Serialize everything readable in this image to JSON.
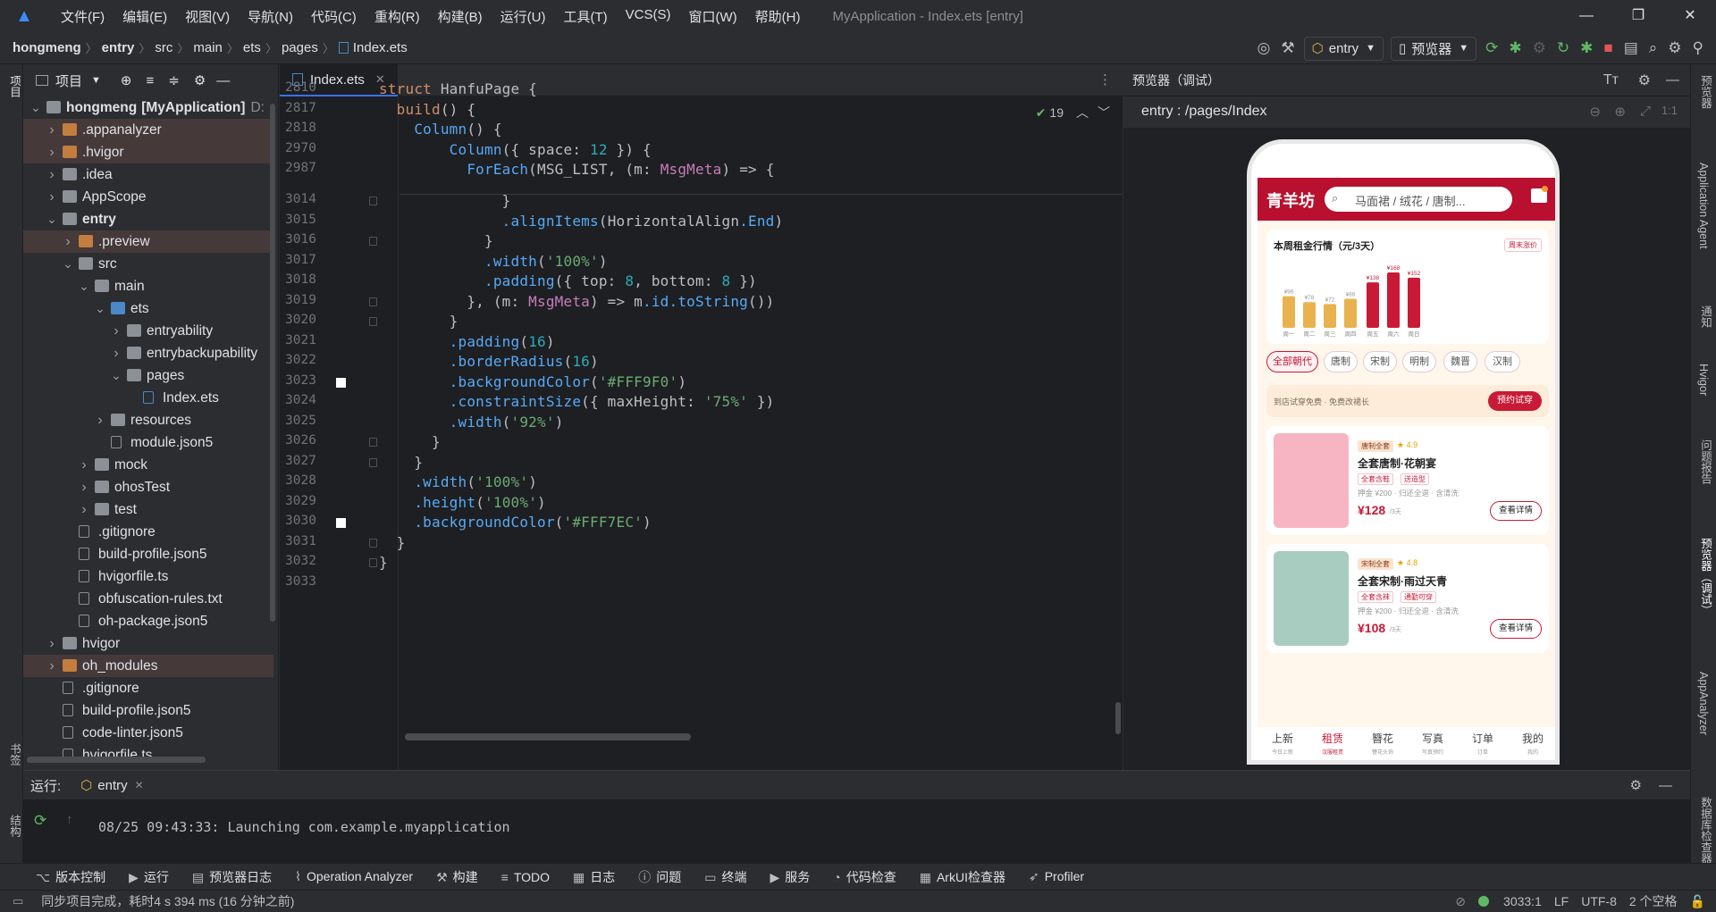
{
  "menubar": {
    "items": [
      "文件(F)",
      "编辑(E)",
      "视图(V)",
      "导航(N)",
      "代码(C)",
      "重构(R)",
      "构建(B)",
      "运行(U)",
      "工具(T)",
      "VCS(S)",
      "窗口(W)",
      "帮助(H)"
    ],
    "title": "MyApplication - Index.ets [entry]"
  },
  "breadcrumb": [
    "hongmeng",
    "entry",
    "src",
    "main",
    "ets",
    "pages",
    "Index.ets"
  ],
  "toolbar": {
    "config": "entry",
    "device": "预览器"
  },
  "project": {
    "header": "项目",
    "tree": [
      {
        "label": "hongmeng",
        "suffix": "[MyApplication]",
        "extra": "D:",
        "depth": 0,
        "open": true,
        "kind": "folder"
      },
      {
        "label": ".appanalyzer",
        "depth": 1,
        "kind": "folder-orange",
        "hl": true
      },
      {
        "label": ".hvigor",
        "depth": 1,
        "kind": "folder-orange",
        "hl": true
      },
      {
        "label": ".idea",
        "depth": 1,
        "kind": "folder"
      },
      {
        "label": "AppScope",
        "depth": 1,
        "kind": "folder"
      },
      {
        "label": "entry",
        "depth": 1,
        "open": true,
        "kind": "folder",
        "bold": true
      },
      {
        "label": ".preview",
        "depth": 2,
        "kind": "folder-orange",
        "hl": true
      },
      {
        "label": "src",
        "depth": 2,
        "open": true,
        "kind": "folder"
      },
      {
        "label": "main",
        "depth": 3,
        "open": true,
        "kind": "folder"
      },
      {
        "label": "ets",
        "depth": 4,
        "open": true,
        "kind": "folder-blue"
      },
      {
        "label": "entryability",
        "depth": 5,
        "kind": "folder"
      },
      {
        "label": "entrybackupability",
        "depth": 5,
        "kind": "folder"
      },
      {
        "label": "pages",
        "depth": 5,
        "open": true,
        "kind": "folder"
      },
      {
        "label": "Index.ets",
        "depth": 6,
        "kind": "ets",
        "noarrow": true
      },
      {
        "label": "resources",
        "depth": 4,
        "kind": "folder"
      },
      {
        "label": "module.json5",
        "depth": 4,
        "kind": "file",
        "noarrow": true
      },
      {
        "label": "mock",
        "depth": 3,
        "kind": "folder"
      },
      {
        "label": "ohosTest",
        "depth": 3,
        "kind": "folder"
      },
      {
        "label": "test",
        "depth": 3,
        "kind": "folder"
      },
      {
        "label": ".gitignore",
        "depth": 2,
        "kind": "file",
        "noarrow": true
      },
      {
        "label": "build-profile.json5",
        "depth": 2,
        "kind": "file",
        "noarrow": true
      },
      {
        "label": "hvigorfile.ts",
        "depth": 2,
        "kind": "file",
        "noarrow": true
      },
      {
        "label": "obfuscation-rules.txt",
        "depth": 2,
        "kind": "file",
        "noarrow": true
      },
      {
        "label": "oh-package.json5",
        "depth": 2,
        "kind": "file",
        "noarrow": true
      },
      {
        "label": "hvigor",
        "depth": 1,
        "kind": "folder"
      },
      {
        "label": "oh_modules",
        "depth": 1,
        "kind": "folder-orange",
        "hl": true
      },
      {
        "label": ".gitignore",
        "depth": 1,
        "kind": "file",
        "noarrow": true
      },
      {
        "label": "build-profile.json5",
        "depth": 1,
        "kind": "file",
        "noarrow": true
      },
      {
        "label": "code-linter.json5",
        "depth": 1,
        "kind": "file",
        "noarrow": true
      },
      {
        "label": "hvigorfile.ts",
        "depth": 1,
        "kind": "file",
        "noarrow": true
      }
    ]
  },
  "editor": {
    "tab": "Index.ets",
    "warnings": "19",
    "sticky": [
      {
        "ln": "2810",
        "code": "struct HanfuPage {"
      },
      {
        "ln": "2817",
        "code": "  build() {"
      },
      {
        "ln": "2818",
        "code": "    Column() {"
      },
      {
        "ln": "2970",
        "code": "        Column({ space: 12 }) {"
      },
      {
        "ln": "2987",
        "code": "          ForEach(MSG_LIST, (m: MsgMeta) => {"
      }
    ],
    "lines": [
      {
        "ln": "3014",
        "code": "              }"
      },
      {
        "ln": "3015",
        "code": "              .alignItems(HorizontalAlign.End)"
      },
      {
        "ln": "3016",
        "code": "            }"
      },
      {
        "ln": "3017",
        "code": "            .width('100%')"
      },
      {
        "ln": "3018",
        "code": "            .padding({ top: 8, bottom: 8 })"
      },
      {
        "ln": "3019",
        "code": "          }, (m: MsgMeta) => m.id.toString())"
      },
      {
        "ln": "3020",
        "code": "        }"
      },
      {
        "ln": "3021",
        "code": "        .padding(16)"
      },
      {
        "ln": "3022",
        "code": "        .borderRadius(16)"
      },
      {
        "ln": "3023",
        "code": "        .backgroundColor('#FFF9F0')"
      },
      {
        "ln": "3024",
        "code": "        .constraintSize({ maxHeight: '75%' })"
      },
      {
        "ln": "3025",
        "code": "        .width('92%')"
      },
      {
        "ln": "3026",
        "code": "      }"
      },
      {
        "ln": "3027",
        "code": "    }"
      },
      {
        "ln": "3028",
        "code": "    .width('100%')"
      },
      {
        "ln": "3029",
        "code": "    .height('100%')"
      },
      {
        "ln": "3030",
        "code": "    .backgroundColor('#FFF7EC')"
      },
      {
        "ln": "3031",
        "code": "  }"
      },
      {
        "ln": "3032",
        "code": "}"
      },
      {
        "ln": "3033",
        "code": ""
      }
    ]
  },
  "preview": {
    "header": "预览器（调试）",
    "route": "entry : /pages/Index",
    "app": {
      "brand": "青羊坊",
      "search_placeholder": "马面裙 / 绒花 / 唐制...",
      "chart_title": "本周租金行情（元/3天）",
      "chart_badge": "周末涨价",
      "chart_data": {
        "type": "bar",
        "categories": [
          "周一",
          "周二",
          "周三",
          "周四",
          "周五",
          "周六",
          "周日"
        ],
        "values": [
          96,
          78,
          72,
          88,
          138,
          168,
          152
        ],
        "labels": [
          "¥96",
          "¥78",
          "¥72",
          "¥88",
          "¥138",
          "¥168",
          "¥152"
        ],
        "colors": {
          "weekday": "#e8b24f",
          "weekend": "#c81a36"
        }
      },
      "chips": [
        "全部朝代",
        "唐制",
        "宋制",
        "明制",
        "魏晋",
        "汉制"
      ],
      "promo_text": "到店试穿免费 · 免费改裙长",
      "promo_btn": "预约试穿",
      "products": [
        {
          "tag": "唐制全套",
          "rating": "★ 4.9",
          "name": "全套唐制·花朝宴",
          "tags": [
            "全套含鞋",
            "送造型"
          ],
          "meta": "押金 ¥200 · 归还全退 · 含清洗",
          "price": "¥128",
          "unit": "/3天",
          "btn": "查看详情",
          "color": "#f7b5c4"
        },
        {
          "tag": "宋制全套",
          "rating": "★ 4.8",
          "name": "全套宋制·雨过天青",
          "tags": [
            "全套含袜",
            "通勤可穿"
          ],
          "meta": "押金 ¥200 · 归还全退 · 含清洗",
          "price": "¥108",
          "unit": "/3天",
          "btn": "查看详情",
          "color": "#a9ccc0"
        }
      ],
      "tabs": [
        {
          "label": "上新",
          "sub": "今日上新"
        },
        {
          "label": "租赁",
          "sub": "汉服租赁",
          "active": true
        },
        {
          "label": "簪花",
          "sub": "簪花头饰"
        },
        {
          "label": "写真",
          "sub": "写真预约"
        },
        {
          "label": "订单",
          "sub": "订单"
        },
        {
          "label": "我的",
          "sub": "我的"
        }
      ]
    }
  },
  "run": {
    "label": "运行:",
    "config": "entry",
    "log": "08/25 09:43:33: Launching com.example.myapplication"
  },
  "bottom_tools": [
    "版本控制",
    "运行",
    "预览器日志",
    "Operation Analyzer",
    "构建",
    "TODO",
    "日志",
    "问题",
    "终端",
    "服务",
    "代码检查",
    "ArkUI检查器",
    "Profiler"
  ],
  "status": {
    "message": "同步项目完成，耗时4 s 394 ms (16 分钟之前)",
    "position": "3033:1",
    "eol": "LF",
    "encoding": "UTF-8",
    "indent": "2 个空格"
  },
  "left_strip": [
    "项目",
    "书签",
    "结构"
  ],
  "right_strip": [
    "预览器",
    "Application Agent",
    "通知",
    "Hvigor",
    "问题报告",
    "预览器（调试）",
    "AppAnalyzer",
    "数据库检查器"
  ]
}
